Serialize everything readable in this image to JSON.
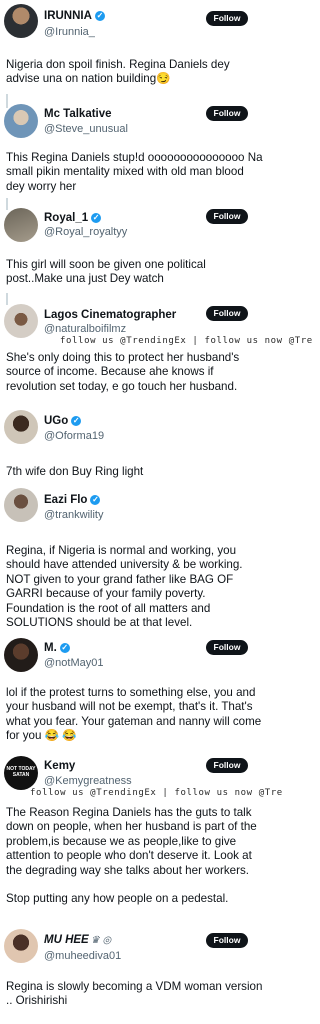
{
  "follow_label": "Follow",
  "watermark": "follow us @TrendingEx | follow us now @Tre",
  "tweets": [
    {
      "name": "IRUNNIA",
      "handle": "@Irunnia_",
      "verified": true,
      "text": "Nigeria don spoil finish. Regina Daniels dey advise una on nation building😏"
    },
    {
      "name": "Mc Talkative",
      "handle": "@Steve_unusual",
      "verified": false,
      "text": "This Regina Daniels stup!d ooooooooooooooo Na small pikin mentality mixed with old man blood dey worry her"
    },
    {
      "name": "Royal_1",
      "handle": "@Royal_royaltyy",
      "verified": true,
      "text": "This girl will soon be given one political post..Make una just Dey watch"
    },
    {
      "name": "Lagos Cinematographer",
      "handle": "@naturalboifilmz",
      "verified": false,
      "text": "She's only doing this to protect her husband's source of income. Because ahe knows if revolution set today, e go touch her husband."
    },
    {
      "name": "UGo",
      "handle": "@Oforma19",
      "verified": true,
      "text": "7th wife don Buy Ring light"
    },
    {
      "name": "Eazi Flo",
      "handle": "@trankwility",
      "verified": true,
      "text": "Regina, if Nigeria is normal and working, you should have attended university & be working. NOT given to your grand father like BAG OF GARRI because of  your family poverty. Foundation is the root of all matters and SOLUTIONS should be at that level."
    },
    {
      "name": "M.",
      "handle": "@notMay01",
      "verified": true,
      "text": "lol if the protest turns to something else, you and your husband will not be exempt, that's it. That's what you fear. Your gateman and nanny will come for you 😂 😂"
    },
    {
      "name": "Kemy",
      "handle": "@Kemygreatness",
      "verified": false,
      "avatar_text": "NOT TODAY SATAN",
      "text": "The Reason Regina Daniels has the guts to talk down on people, when her husband is part of the problem,is because we as people,like to give attention to people who don't deserve it. Look at the degrading way she talks about her workers.\n\nStop putting any how people on a pedestal."
    },
    {
      "name": "MU HEE",
      "handle": "@muheediva01",
      "verified": false,
      "crown": "♛ ◎",
      "text": "Regina is slowly becoming a VDM woman version .. Orishirishi"
    }
  ],
  "colors": {
    "follow_bg": "#0f1419",
    "verified": "#1d9bf0",
    "handle": "#536471",
    "thread": "#cfd9de"
  }
}
